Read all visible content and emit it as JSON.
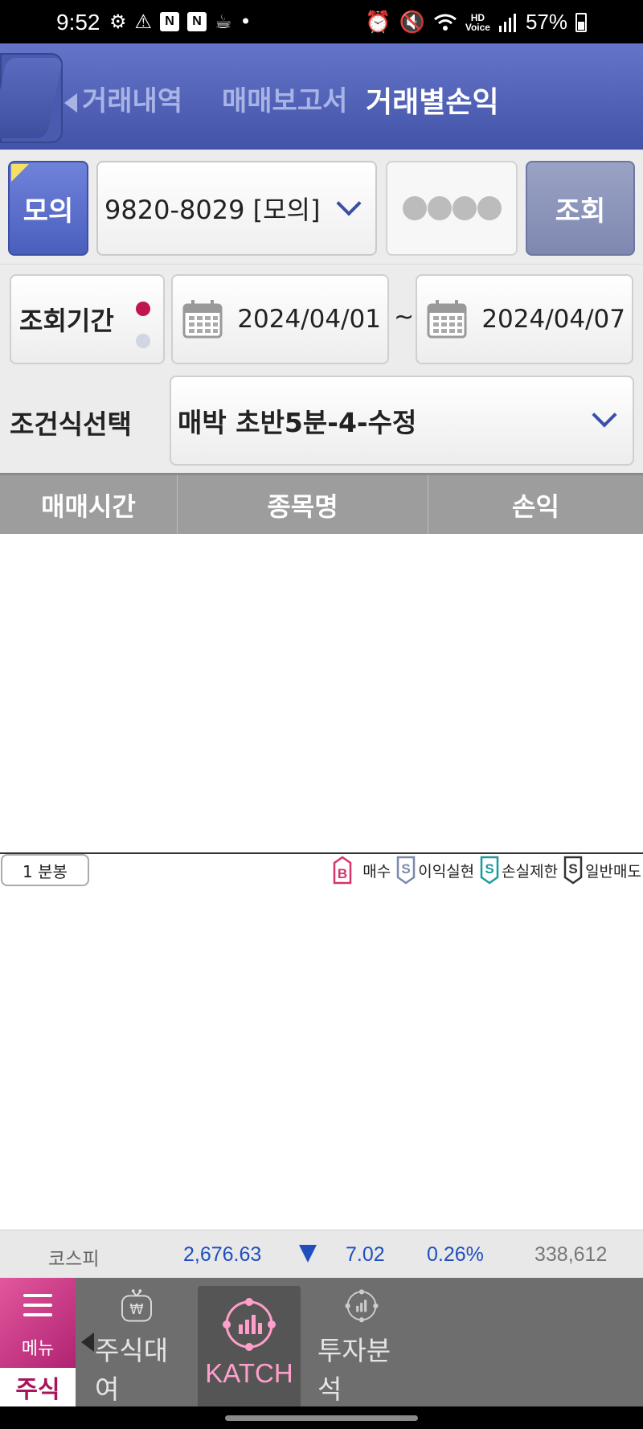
{
  "status_bar": {
    "time": "9:52",
    "battery": "57%",
    "left_icons": [
      "gear-icon",
      "warning-icon",
      "naver-icon",
      "naver-icon",
      "coffee-icon",
      "dot-icon"
    ],
    "right_icons": [
      "alarm-icon",
      "mute-icon",
      "wifi-icon",
      "hd-voice-icon",
      "signal-icon",
      "battery-icon"
    ]
  },
  "header": {
    "tabs": [
      "거래내역",
      "매매보고서",
      "거래별손익"
    ],
    "active_tab": "거래별손익"
  },
  "account": {
    "mock_label": "모의",
    "account_number": "9820-8029 [모의]",
    "query_label": "조회"
  },
  "period": {
    "label": "조회기간",
    "from": "2024/04/01",
    "separator": "~",
    "to": "2024/04/07"
  },
  "condition": {
    "label": "조건식선택",
    "value": "매박 초반5분-4-수정"
  },
  "table": {
    "columns": [
      "매매시간",
      "종목명",
      "손익"
    ],
    "rows": []
  },
  "chart": {
    "interval": "1 분봉",
    "legend": [
      {
        "badge": "B",
        "label": "매수",
        "color": "#d6336c"
      },
      {
        "badge": "S",
        "label": "이익실현",
        "color": "#7a8aa8"
      },
      {
        "badge": "S",
        "label": "손실제한",
        "color": "#1a9c9c"
      },
      {
        "badge": "S",
        "label": "일반매도",
        "color": "#333333"
      }
    ]
  },
  "ticker": {
    "name": "코스피",
    "value": "2,676.63",
    "direction": "down",
    "change": "7.02",
    "percent": "0.26%",
    "volume": "338,612",
    "color": "#1f4fbf"
  },
  "bottom_nav": {
    "menu_label": "메뉴",
    "stock_tab": "주식",
    "items": [
      "주식대여",
      "KATCH",
      "투자분석"
    ],
    "active_item": "KATCH",
    "accent": "#c8327f"
  }
}
